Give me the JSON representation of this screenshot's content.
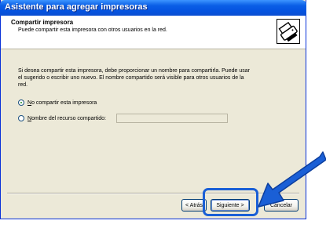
{
  "window": {
    "title": "Asistente para agregar impresoras"
  },
  "header": {
    "title": "Compartir impresora",
    "subtitle": "Puede compartir esta impresora con otros usuarios en la red.",
    "icon": "printer-icon"
  },
  "content": {
    "description": "Si desea compartir esta impresora, debe proporcionar un nombre para compartirla. Puede usar el sugerido o escribir uno nuevo. El nombre compartido será visible para otros usuarios de la red.",
    "options": [
      {
        "label": "No compartir esta impresora",
        "checked": true
      },
      {
        "label": "Nombre del recurso compartido:",
        "checked": false
      }
    ],
    "share_name_value": ""
  },
  "buttons": {
    "back": "< Atrás",
    "next": "Siguiente >",
    "cancel": "Cancelar"
  },
  "annotation": {
    "color": "#1a5fd6"
  }
}
